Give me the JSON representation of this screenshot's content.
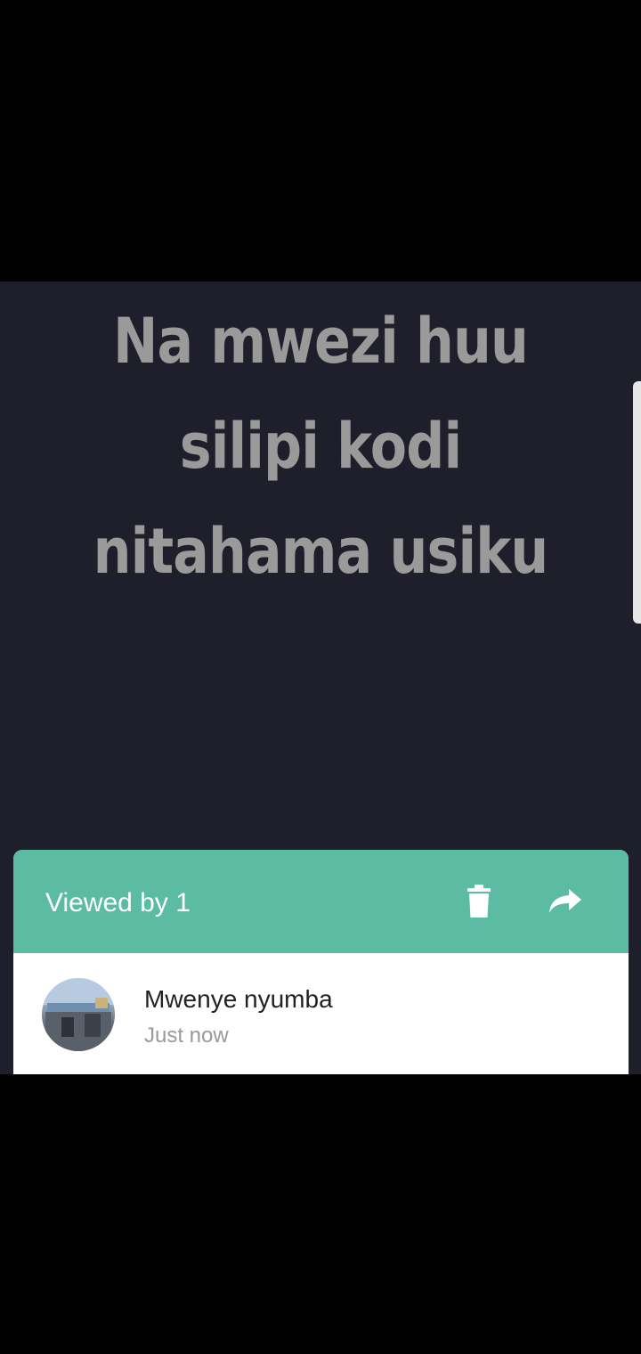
{
  "status": {
    "text_lines": [
      "Na mwezi huu",
      "silipi kodi",
      "nitahama usiku"
    ],
    "background_color": "#1e1f2a",
    "text_color": "#9a9a9a"
  },
  "viewers_panel": {
    "header_color": "#5cbba3",
    "viewed_by_label": "Viewed by 1",
    "actions": [
      {
        "icon": "delete-icon"
      },
      {
        "icon": "forward-icon"
      }
    ],
    "viewers": [
      {
        "name": "Mwenye nyumba",
        "time": "Just now",
        "avatar_icon": "avatar"
      }
    ]
  }
}
